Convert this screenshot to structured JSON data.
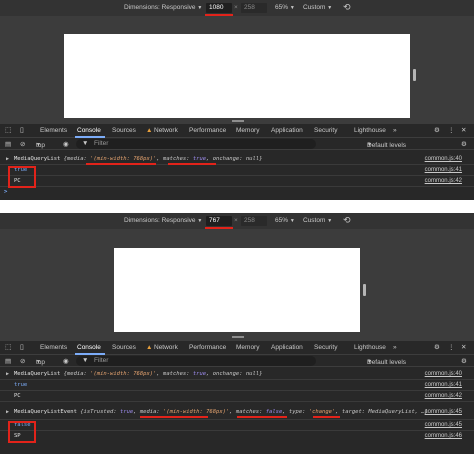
{
  "top": {
    "dims_label": "Dimensions: Responsive",
    "width_value": "1080",
    "height_value": "258",
    "zoom": "65%",
    "throttle": "Custom",
    "tabs": [
      "Elements",
      "Console",
      "Sources",
      "Network",
      "Performance",
      "Memory",
      "Application",
      "Security",
      "Lighthouse"
    ],
    "more_tabs": "»",
    "context": "top",
    "filter_placeholder": "Filter",
    "levels": "Default levels",
    "console": [
      {
        "parts": [
          [
            "MediaQueryList ",
            ""
          ],
          [
            "{media: ",
            "key"
          ],
          [
            "'(min-width: 768px)'",
            "str"
          ],
          [
            ", matches: ",
            "key"
          ],
          [
            "true",
            "kw"
          ],
          [
            ", onchange: ",
            "key"
          ],
          [
            "null",
            "key"
          ],
          [
            "}",
            "key"
          ]
        ],
        "source": "common.js:40"
      },
      {
        "text": "true",
        "source": "common.js:41"
      },
      {
        "text": "PC",
        "source": "common.js:42"
      }
    ],
    "prompt": ">"
  },
  "bottom": {
    "dims_label": "Dimensions: Responsive",
    "width_value": "767",
    "height_value": "258",
    "zoom": "65%",
    "throttle": "Custom",
    "tabs": [
      "Elements",
      "Console",
      "Sources",
      "Network",
      "Performance",
      "Memory",
      "Application",
      "Security",
      "Lighthouse"
    ],
    "more_tabs": "»",
    "context": "top",
    "filter_placeholder": "Filter",
    "levels": "Default levels",
    "console": [
      {
        "parts": [
          [
            "MediaQueryList ",
            ""
          ],
          [
            "{media: ",
            "key"
          ],
          [
            "'(min-width: 768px)'",
            "str"
          ],
          [
            ", matches: ",
            "key"
          ],
          [
            "true",
            "kw"
          ],
          [
            ", onchange: ",
            "key"
          ],
          [
            "null",
            "key"
          ],
          [
            "}",
            "key"
          ]
        ],
        "source": "common.js:40"
      },
      {
        "text": "true",
        "source": "common.js:41"
      },
      {
        "text": "PC",
        "source": "common.js:42"
      },
      {
        "parts": [
          [
            "MediaQueryListEvent ",
            ""
          ],
          [
            "{isTrusted: ",
            "key"
          ],
          [
            "true",
            "kw"
          ],
          [
            ", media: ",
            "key"
          ],
          [
            "'(min-width: 768px)'",
            "str"
          ],
          [
            ", matches: ",
            "key"
          ],
          [
            "false",
            "kw"
          ],
          [
            ", type: ",
            "key"
          ],
          [
            "'change'",
            "str"
          ],
          [
            ", target: MediaQueryList, …}",
            "key"
          ]
        ],
        "source": "common.js:45"
      },
      {
        "text": "false",
        "source": "common.js:45"
      },
      {
        "text": "SP",
        "source": "common.js:46"
      }
    ]
  },
  "colors": {
    "highlight": "#e2231a",
    "boolean": "#7cacf8",
    "string": "#e5a36f"
  },
  "icons": [
    "rotate-icon",
    "inspect-icon",
    "device-toggle-icon",
    "gear-icon",
    "kebab-menu-icon",
    "close-icon",
    "clear-console-icon",
    "eye-icon",
    "more-tabs-icon"
  ]
}
